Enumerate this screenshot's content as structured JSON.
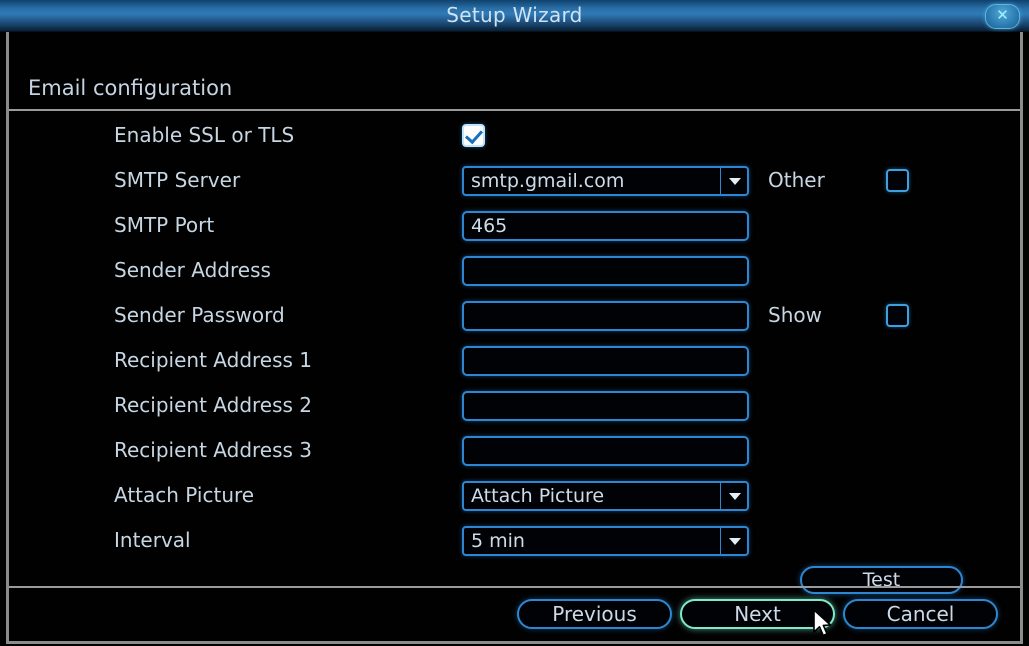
{
  "window": {
    "title": "Setup Wizard",
    "close_icon": "close-icon",
    "close_glyph": "✕"
  },
  "section": {
    "title": "Email configuration"
  },
  "colors": {
    "accent_blue": "#2f86d0",
    "titlebar_blue": "#2f7ab6",
    "focus_green": "#7fe9c8",
    "text": "#c7d6e3",
    "background": "#010101"
  },
  "form": {
    "rows": [
      {
        "label": "Enable SSL or TLS",
        "control": "checkbox",
        "checked": true
      },
      {
        "label": "SMTP Server",
        "control": "dropdown",
        "value": "smtp.gmail.com",
        "side_label": "Other",
        "side_checked": false
      },
      {
        "label": "SMTP Port",
        "control": "input",
        "value": "465",
        "placeholder": ""
      },
      {
        "label": "Sender Address",
        "control": "input",
        "value": "",
        "placeholder": ""
      },
      {
        "label": "Sender Password",
        "control": "input",
        "value": "",
        "placeholder": "",
        "side_label": "Show",
        "side_checked": false
      },
      {
        "label": "Recipient Address 1",
        "control": "input",
        "value": "",
        "placeholder": ""
      },
      {
        "label": "Recipient Address 2",
        "control": "input",
        "value": "",
        "placeholder": ""
      },
      {
        "label": "Recipient Address 3",
        "control": "input",
        "value": "",
        "placeholder": ""
      },
      {
        "label": "Attach Picture",
        "control": "dropdown",
        "value": "Attach Picture"
      },
      {
        "label": "Interval",
        "control": "dropdown",
        "value": "5 min"
      }
    ],
    "test_button": "Test"
  },
  "footer": {
    "previous": "Previous",
    "next": "Next",
    "cancel": "Cancel",
    "focused_button": "Next"
  }
}
